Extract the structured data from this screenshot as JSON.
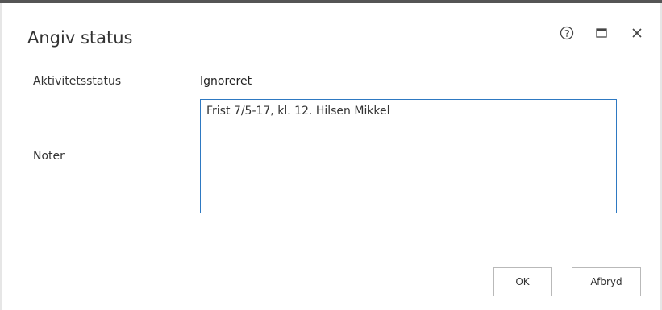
{
  "dialog": {
    "title": "Angiv status",
    "header_icons": [
      "help-icon",
      "maximize-icon",
      "close-icon"
    ]
  },
  "form": {
    "status_label": "Aktivitetsstatus",
    "status_value": "Ignoreret",
    "notes_label": "Noter",
    "notes_value": "Frist 7/5-17, kl. 12. Hilsen Mikkel"
  },
  "buttons": {
    "ok_label": "OK",
    "cancel_label": "Afbryd"
  },
  "colors": {
    "focus_border": "#2e79c2",
    "text": "#333333"
  }
}
